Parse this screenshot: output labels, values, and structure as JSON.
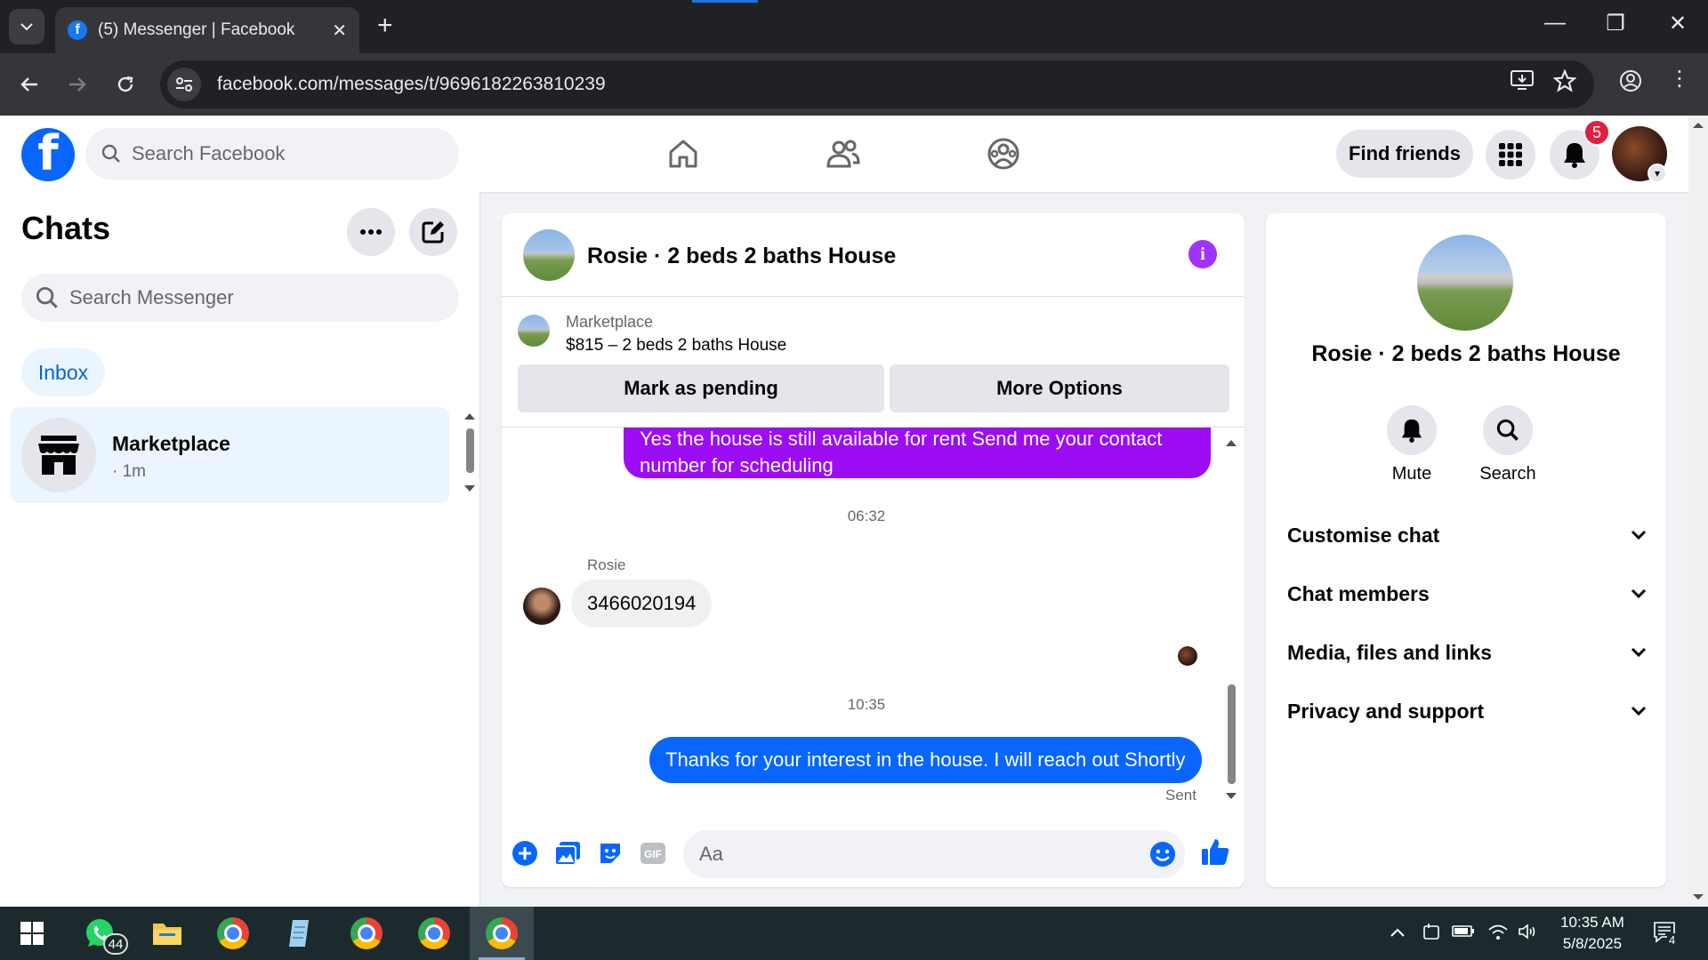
{
  "browser": {
    "tab_title": "(5) Messenger | Facebook",
    "url": "facebook.com/messages/t/9696182263810239"
  },
  "fb": {
    "search_placeholder": "Search Facebook",
    "find_friends": "Find friends",
    "notification_count": "5",
    "brand_color": "#0866ff"
  },
  "chats": {
    "title": "Chats",
    "search_placeholder": "Search Messenger",
    "inbox_label": "Inbox",
    "items": [
      {
        "name": "Marketplace",
        "time": "· 1m"
      }
    ]
  },
  "conversation": {
    "title": "Rosie · 2 beds 2 baths House",
    "marketplace_label": "Marketplace",
    "listing": "$815 – 2 beds 2 baths House",
    "mark_pending": "Mark as pending",
    "more_options": "More Options",
    "messages": {
      "outgoing_1": "Yes the house is still available for rent Send me your contact number for scheduling",
      "time_1": "06:32",
      "sender_name": "Rosie",
      "incoming_1": "3466020194",
      "time_2": "10:35",
      "outgoing_2": "Thanks for your interest in the house. I will reach out Shortly",
      "status": "Sent"
    },
    "composer_placeholder": "Aa",
    "accent_color": "#a033ff"
  },
  "info_panel": {
    "title": "Rosie · 2 beds 2 baths House",
    "mute": "Mute",
    "search": "Search",
    "sections": [
      "Customise chat",
      "Chat members",
      "Media, files and links",
      "Privacy and support"
    ]
  },
  "taskbar": {
    "whatsapp_badge": "44",
    "time": "10:35 AM",
    "date": "5/8/2025",
    "notifications": "4"
  }
}
